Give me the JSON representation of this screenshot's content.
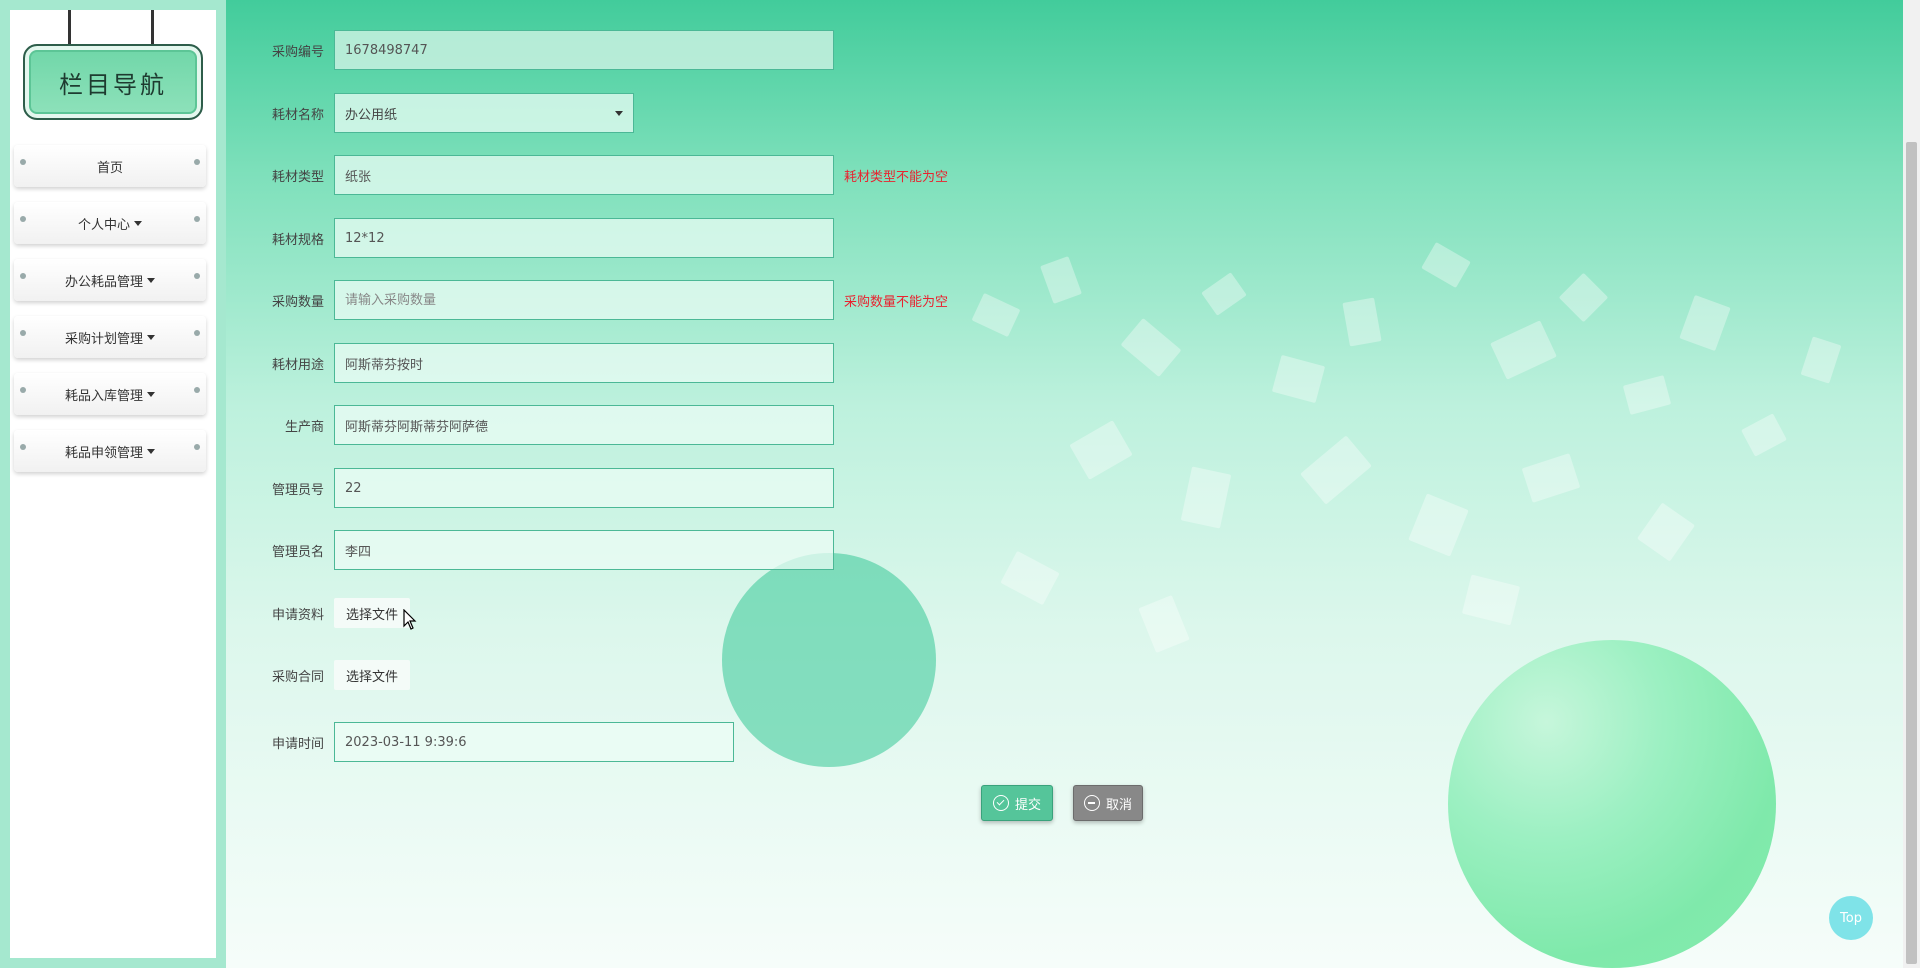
{
  "sidebar": {
    "title": "栏目导航",
    "items": [
      {
        "label": "首页",
        "has_dropdown": false
      },
      {
        "label": "个人中心",
        "has_dropdown": true
      },
      {
        "label": "办公耗品管理",
        "has_dropdown": true
      },
      {
        "label": "采购计划管理",
        "has_dropdown": true
      },
      {
        "label": "耗品入库管理",
        "has_dropdown": true
      },
      {
        "label": "耗品申领管理",
        "has_dropdown": true
      }
    ]
  },
  "form": {
    "purchase_no": {
      "label": "采购编号",
      "value": "1678498747"
    },
    "material_name": {
      "label": "耗材名称",
      "value": "办公用纸"
    },
    "material_type": {
      "label": "耗材类型",
      "value": "纸张",
      "error": "耗材类型不能为空"
    },
    "material_spec": {
      "label": "耗材规格",
      "value": "12*12"
    },
    "purchase_qty": {
      "label": "采购数量",
      "placeholder": "请输入采购数量",
      "error": "采购数量不能为空"
    },
    "material_use": {
      "label": "耗材用途",
      "value": "阿斯蒂芬按时"
    },
    "manufacturer": {
      "label": "生产商",
      "value": "阿斯蒂芬阿斯蒂芬阿萨德"
    },
    "admin_no": {
      "label": "管理员号",
      "value": "22"
    },
    "admin_name": {
      "label": "管理员名",
      "value": "李四"
    },
    "apply_docs": {
      "label": "申请资料",
      "button": "选择文件"
    },
    "purchase_contract": {
      "label": "采购合同",
      "button": "选择文件"
    },
    "apply_time": {
      "label": "申请时间",
      "value": "2023-03-11 9:39:6"
    }
  },
  "actions": {
    "submit": "提交",
    "cancel": "取消"
  },
  "top_button": "Top",
  "colors": {
    "accent": "#55c59a",
    "error": "#e8232f",
    "cancel": "#888888",
    "border": "#4bb896"
  }
}
